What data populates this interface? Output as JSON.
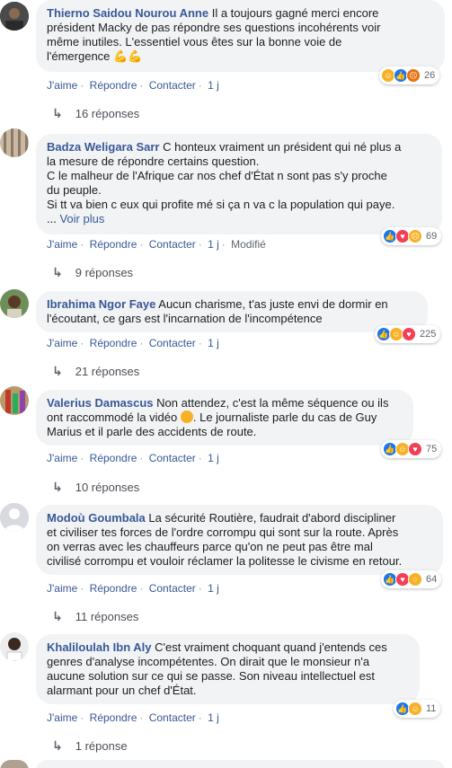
{
  "comments": [
    {
      "author": "Thierno Saidou Nourou Anne",
      "lines": [
        "Il a toujours gagné merci encore",
        "président Macky de pas répondre ses questions incohérents voir",
        "même inutiles. L'essentiel vous êtes sur la bonne voie de",
        "l'émergence"
      ],
      "emoji_after": "💪💪",
      "actions": {
        "like": "J'aime",
        "reply": "Répondre",
        "contact": "Contacter",
        "time": "1 j"
      },
      "reactions": {
        "icons": [
          "haha",
          "like",
          "angry"
        ],
        "count": "26"
      },
      "replies": "16 réponses"
    },
    {
      "author": "Badza Weligara Sarr",
      "lines": [
        "C honteux vraiment un président qui né plus a",
        "la mesure de répondre certains question.",
        "C le malheur de l'Afrique car nos chef d'État n sont pas s'y proche",
        "du peuple.",
        "Si tt va bien c eux qui profite mé si ça n va c la population qui paye."
      ],
      "see_more_prefix": "...",
      "see_more": "Voir plus",
      "actions": {
        "like": "J'aime",
        "reply": "Répondre",
        "contact": "Contacter",
        "time": "1 j",
        "edited": "Modifié"
      },
      "reactions": {
        "icons": [
          "like",
          "love",
          "sad"
        ],
        "count": "69"
      },
      "replies": "9 réponses"
    },
    {
      "author": "Ibrahima Ngor Faye",
      "lines": [
        "Aucun charisme, t'as juste envi de dormir en",
        "l'écoutant, ce gars est l'incarnation de l'incompétence"
      ],
      "actions": {
        "like": "J'aime",
        "reply": "Répondre",
        "contact": "Contacter",
        "time": "1 j"
      },
      "reactions": {
        "icons": [
          "like",
          "haha",
          "love"
        ],
        "count": "225"
      },
      "replies": "21 réponses"
    },
    {
      "author": "Valerius Damascus",
      "lines": [
        "Non attendez, c'est la même séquence ou ils",
        "ont raccommodé la vidéo",
        ". Le journaliste parle du cas de Guy",
        "Marius et il parle des accidents de route."
      ],
      "actions": {
        "like": "J'aime",
        "reply": "Répondre",
        "contact": "Contacter",
        "time": "1 j"
      },
      "reactions": {
        "icons": [
          "like",
          "haha",
          "love"
        ],
        "count": "75"
      },
      "replies": "10 réponses"
    },
    {
      "author": "Modoù Goumbala",
      "lines": [
        "La sécurité Routière, faudrait d'abord discipliner",
        "et civiliser tes forces de l'ordre corrompu qui sont sur la route. Après",
        "on verras avec les chauffeurs parce qu'on ne peut pas être mal",
        "civilisé corrompu et vouloir réclamer la politesse le civisme en retour."
      ],
      "actions": {
        "like": "J'aime",
        "reply": "Répondre",
        "contact": "Contacter",
        "time": "1 j"
      },
      "reactions": {
        "icons": [
          "like",
          "love",
          "wow"
        ],
        "count": "64"
      },
      "replies": "11 réponses"
    },
    {
      "author": "Khaliloulah Ibn Aly",
      "lines": [
        "C'est vraiment choquant quand j'entends ces",
        "genres d'analyse incompétentes. On dirait que le monsieur n'a",
        "aucune solution sur ce qui se passe. Son niveau intellectuel est",
        "alarmant pour un chef d'État."
      ],
      "actions": {
        "like": "J'aime",
        "reply": "Répondre",
        "contact": "Contacter",
        "time": "1 j"
      },
      "reactions": {
        "icons": [
          "like",
          "haha"
        ],
        "count": "11"
      },
      "replies": "1 réponse"
    }
  ],
  "colors": {
    "link": "#385898",
    "bubble": "#f2f3f5",
    "like": "#1877f2",
    "love": "#f33e58",
    "haha": "#f7b125",
    "angry": "#e9710f"
  }
}
